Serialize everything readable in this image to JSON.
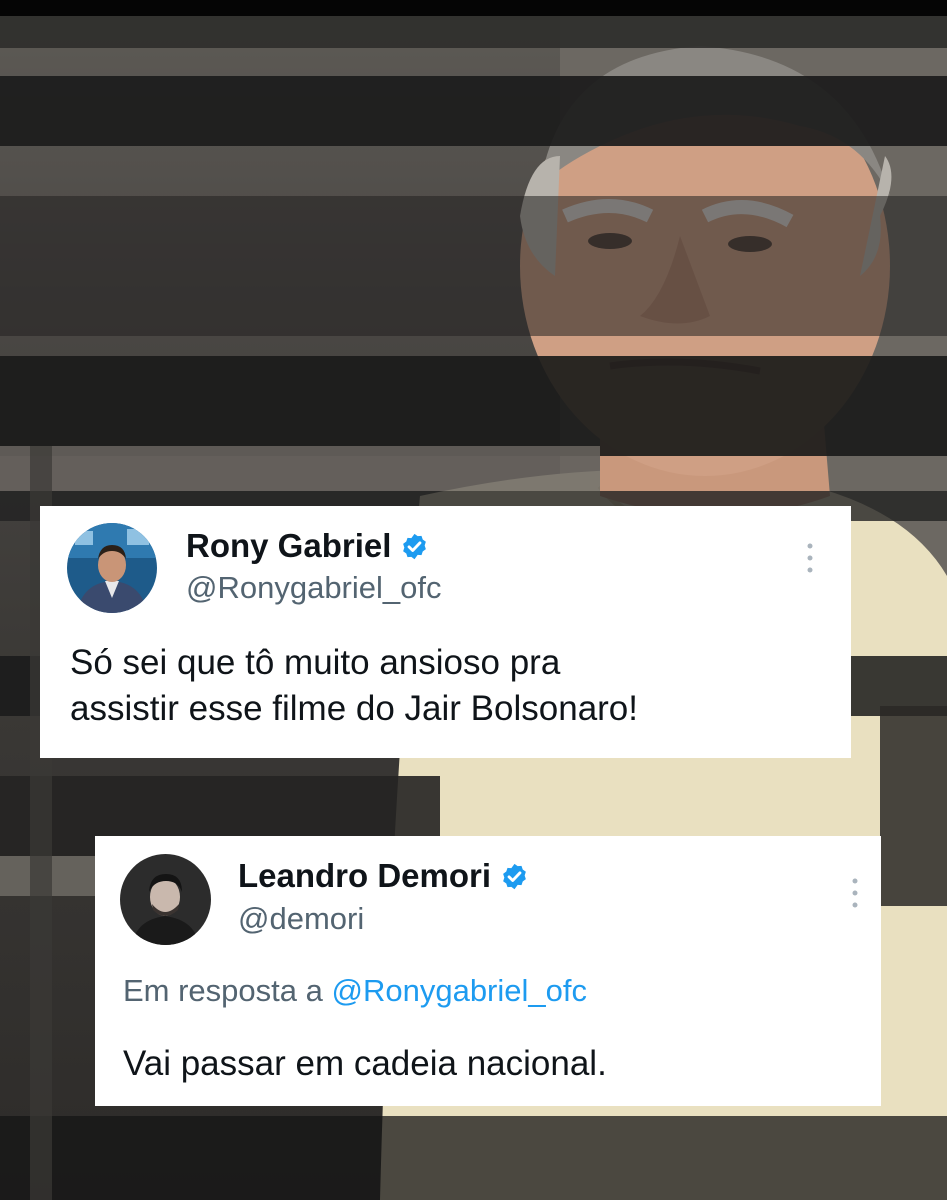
{
  "tweets": [
    {
      "name": "Rony Gabriel",
      "handle": "@Ronygabriel_ofc",
      "text_lines": [
        "Só sei que tô muito ansioso pra",
        "assistir esse filme do Jair Bolsonaro!"
      ],
      "verified": true,
      "avatar_icon": "profile-photo"
    },
    {
      "name": "Leandro Demori",
      "handle": "@demori",
      "reply_prefix": "Em resposta a",
      "reply_to": "@Ronygabriel_ofc",
      "text": "Vai passar em cadeia nacional.",
      "verified": true,
      "avatar_icon": "profile-photo"
    }
  ],
  "colors": {
    "verified_badge": "#1d9bf0",
    "link": "#1d9bf0",
    "secondary_text": "#536471",
    "primary_text": "#0f1419"
  }
}
